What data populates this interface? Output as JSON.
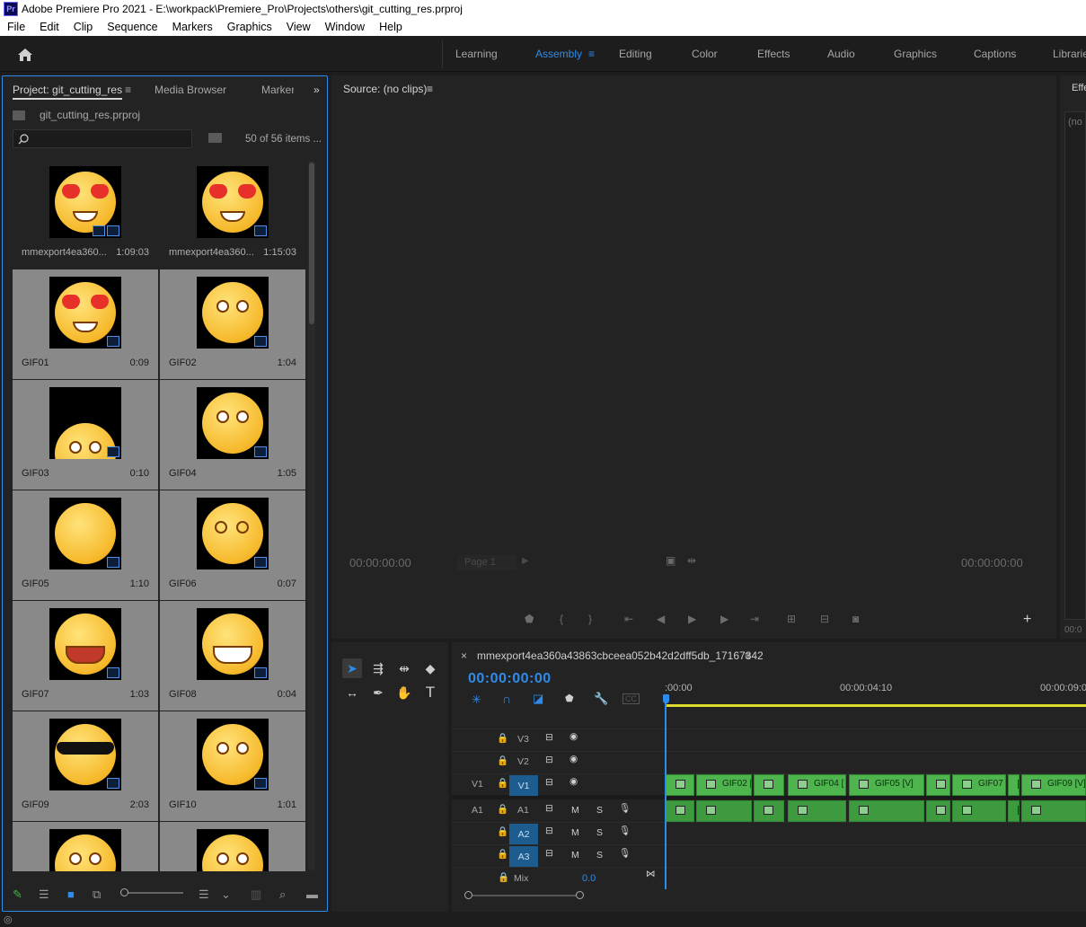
{
  "title_bar": {
    "app_icon": "Pr",
    "title": "Adobe Premiere Pro 2021 - E:\\workpack\\Premiere_Pro\\Projects\\others\\git_cutting_res.prproj"
  },
  "menu": [
    "File",
    "Edit",
    "Clip",
    "Sequence",
    "Markers",
    "Graphics",
    "View",
    "Window",
    "Help"
  ],
  "workspaces": [
    "Learning",
    "Assembly",
    "Editing",
    "Color",
    "Effects",
    "Audio",
    "Graphics",
    "Captions",
    "Librarie"
  ],
  "active_workspace": "Assembly",
  "project_panel": {
    "tabs": [
      "Project: git_cutting_res",
      "Media Browser",
      "Marker"
    ],
    "file": "git_cutting_res.prproj",
    "search_placeholder": "",
    "items_count": "50 of 56 items ...",
    "items": [
      {
        "name": "mmexport4ea360...",
        "duration": "1:09:03",
        "type": "heart-eyes"
      },
      {
        "name": "mmexport4ea360...",
        "duration": "1:15:03",
        "type": "heart-eyes"
      },
      {
        "name": "GIF01",
        "duration": "0:09",
        "type": "heart-eyes"
      },
      {
        "name": "GIF02",
        "duration": "1:04",
        "type": "nosebleed"
      },
      {
        "name": "GIF03",
        "duration": "0:10",
        "type": "peek"
      },
      {
        "name": "GIF04",
        "duration": "1:05",
        "type": "smile"
      },
      {
        "name": "GIF05",
        "duration": "1:10",
        "type": "blank"
      },
      {
        "name": "GIF06",
        "duration": "0:07",
        "type": "dizzy"
      },
      {
        "name": "GIF07",
        "duration": "1:03",
        "type": "cry-open"
      },
      {
        "name": "GIF08",
        "duration": "0:04",
        "type": "grin"
      },
      {
        "name": "GIF09",
        "duration": "2:03",
        "type": "sunglasses"
      },
      {
        "name": "GIF10",
        "duration": "1:01",
        "type": "tears"
      },
      {
        "name": "",
        "duration": "",
        "type": "meh"
      },
      {
        "name": "",
        "duration": "",
        "type": "smile"
      }
    ]
  },
  "source_panel": {
    "title": "Source: (no clips)",
    "timecode_left": "00:00:00:00",
    "timecode_right": "00:00:00:00",
    "page_select": "Page 1"
  },
  "effects_panel": {
    "tab": "Effe",
    "field": "(no",
    "timecode": "00:0"
  },
  "timeline": {
    "sequence_name": "mmexport4ea360a43863cbceea052b42d2dff5db_17167342",
    "timecode": "00:00:00:00",
    "ruler": [
      ":00:00",
      "00:00:04:10",
      "00:00:09:0"
    ],
    "tracks": [
      {
        "name": "V3",
        "kind": "video",
        "label": ""
      },
      {
        "name": "V2",
        "kind": "video",
        "label": ""
      },
      {
        "name": "V1",
        "kind": "video",
        "label": "V1"
      },
      {
        "name": "A1",
        "kind": "audio",
        "label": "A1"
      },
      {
        "name": "A2",
        "kind": "audio",
        "label": ""
      },
      {
        "name": "A3",
        "kind": "audio",
        "label": ""
      }
    ],
    "mix_label": "Mix",
    "mix_value": "0.0",
    "clips": [
      "GIF02 [",
      "GIF04 [",
      "GIF05 [V]",
      "GIF07",
      "GIF09 [V]"
    ]
  },
  "colors": {
    "accent": "#2d8ceb",
    "clip_green": "#4eb54e",
    "work_area": "#e0dc2e"
  }
}
